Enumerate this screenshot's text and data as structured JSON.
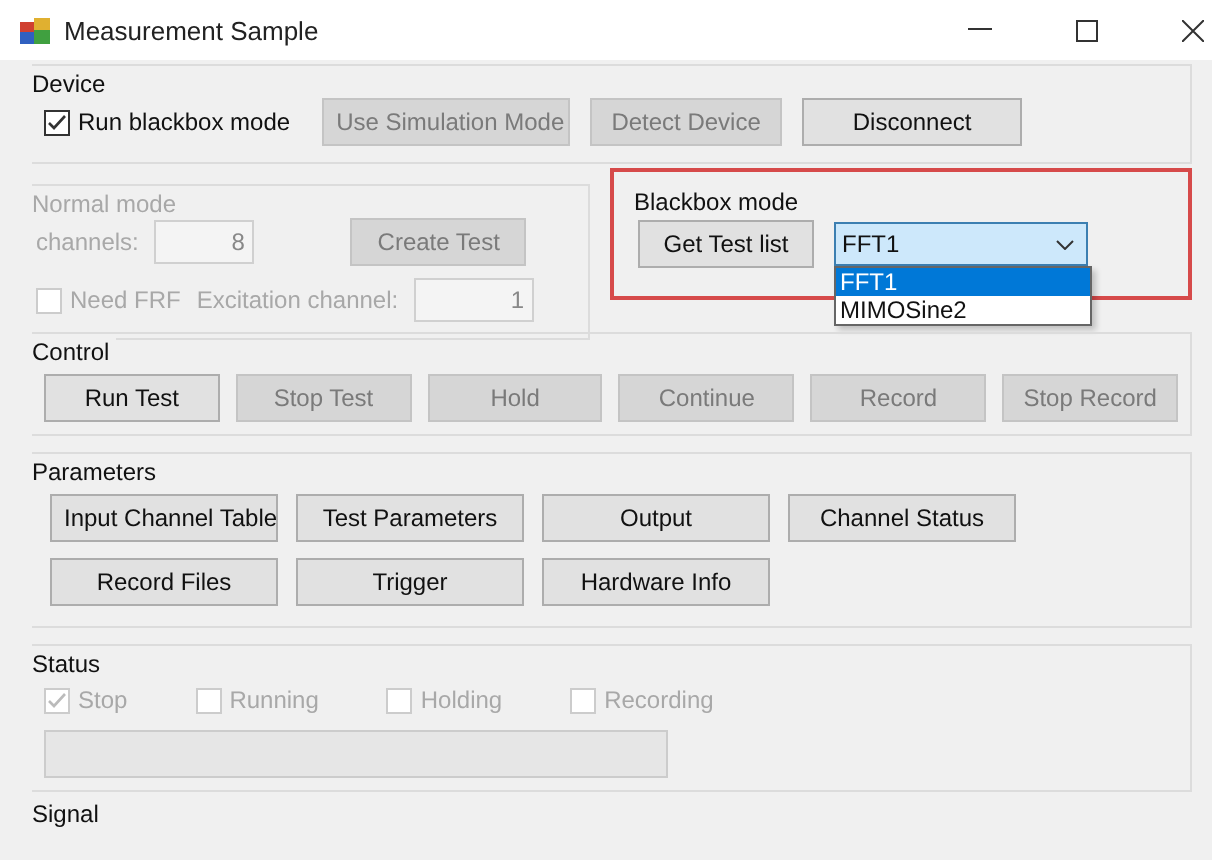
{
  "window": {
    "title": "Measurement Sample"
  },
  "device": {
    "label": "Device",
    "checkbox": {
      "label": "Run blackbox mode",
      "checked": true,
      "disabled": false
    },
    "buttons": [
      {
        "label": "Use Simulation Mode",
        "disabled": true
      },
      {
        "label": "Detect Device",
        "disabled": true
      },
      {
        "label": "Disconnect",
        "disabled": false
      }
    ]
  },
  "normal_mode": {
    "label": "Normal mode",
    "disabled": true,
    "channels_label": "channels:",
    "channels_value": "8",
    "create_button": "Create Test",
    "need_frf": {
      "label": "Need FRF",
      "checked": false
    },
    "excitation_label": "Excitation channel:",
    "excitation_value": "1"
  },
  "blackbox_mode": {
    "label": "Blackbox mode",
    "highlighted": true,
    "button": "Get Test list",
    "combo": {
      "value": "FFT1",
      "expanded": true,
      "options": [
        {
          "label": "FFT1",
          "selected": true
        },
        {
          "label": "MIMOSine2",
          "selected": false
        }
      ]
    }
  },
  "control": {
    "label": "Control",
    "buttons": [
      {
        "label": "Run Test",
        "disabled": false
      },
      {
        "label": "Stop Test",
        "disabled": true
      },
      {
        "label": "Hold",
        "disabled": true
      },
      {
        "label": "Continue",
        "disabled": true
      },
      {
        "label": "Record",
        "disabled": true
      },
      {
        "label": "Stop Record",
        "disabled": true
      }
    ]
  },
  "parameters": {
    "label": "Parameters",
    "buttons": [
      {
        "label": "Input Channel Table"
      },
      {
        "label": "Test Parameters"
      },
      {
        "label": "Output"
      },
      {
        "label": "Channel Status"
      },
      {
        "label": "Record Files"
      },
      {
        "label": "Trigger"
      },
      {
        "label": "Hardware Info"
      }
    ]
  },
  "status": {
    "label": "Status",
    "checkboxes": [
      {
        "label": "Stop",
        "checked": true,
        "disabled": true
      },
      {
        "label": "Running",
        "checked": false,
        "disabled": true
      },
      {
        "label": "Holding",
        "checked": false,
        "disabled": true
      },
      {
        "label": "Recording",
        "checked": false,
        "disabled": true
      }
    ],
    "progress": {
      "level": 0
    }
  },
  "signal": {
    "label": "Signal"
  }
}
